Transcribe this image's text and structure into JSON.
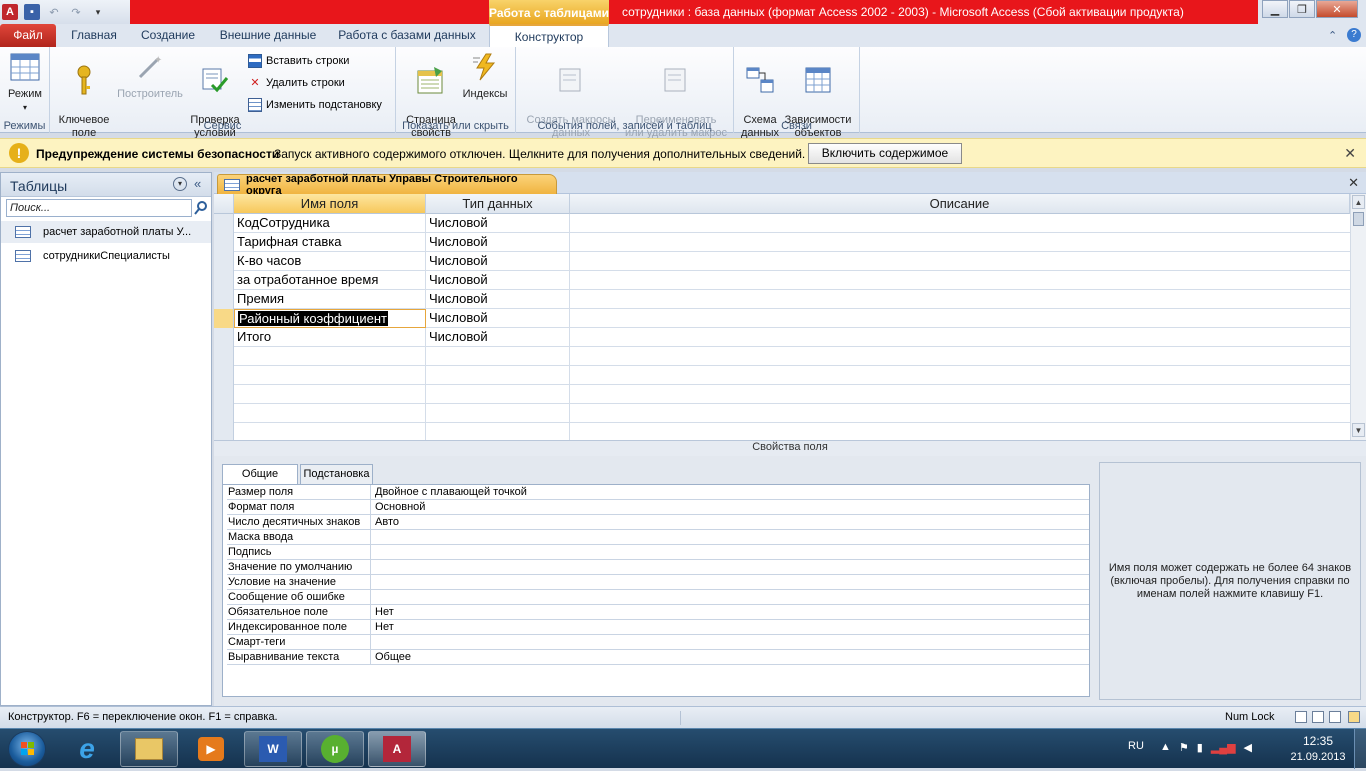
{
  "titlebar": {
    "context_tab": "Работа с таблицами",
    "window_title": "сотрудники : база данных (формат Access 2002 - 2003)  -  Microsoft Access (Сбой активации продукта)"
  },
  "tabs": {
    "file": "Файл",
    "home": "Главная",
    "create": "Создание",
    "external": "Внешние данные",
    "dbtools": "Работа с базами данных",
    "constructor": "Конструктор"
  },
  "ribbon": {
    "mode_label": "Режим",
    "group_modes": "Режимы",
    "key_field": "Ключевое\nполе",
    "builder": "Построитель",
    "check_conditions": "Проверка\nусловий",
    "insert_rows": "Вставить строки",
    "delete_rows": "Удалить строки",
    "change_lookup": "Изменить подстановку",
    "group_service": "Сервис",
    "property_sheet": "Страница\nсвойств",
    "indexes": "Индексы",
    "group_showhide": "Показать или скрыть",
    "create_macros": "Создать макросы\nданных",
    "rename_macro": "Переименовать\nили удалить макрос",
    "group_events": "События полей, записей и таблиц",
    "data_schema": "Схема\nданных",
    "dependencies": "Зависимости\nобъектов",
    "group_relations": "Связи"
  },
  "security": {
    "title": "Предупреждение системы безопасности",
    "message": "Запуск активного содержимого отключен. Щелкните для получения дополнительных сведений.",
    "button": "Включить содержимое"
  },
  "nav": {
    "title": "Таблицы",
    "search_placeholder": "Поиск...",
    "items": [
      {
        "label": "расчет заработной платы У..."
      },
      {
        "label": "сотрудникиСпециалисты"
      }
    ]
  },
  "document": {
    "tab_title": "расчет заработной платы Управы Строительного округа",
    "columns": [
      "Имя поля",
      "Тип данных",
      "Описание"
    ],
    "rows": [
      {
        "name": "КодСотрудника",
        "type": "Числовой"
      },
      {
        "name": "Тарифная ставка",
        "type": "Числовой"
      },
      {
        "name": "К-во часов",
        "type": "Числовой"
      },
      {
        "name": "за отработанное время",
        "type": "Числовой"
      },
      {
        "name": "Премия",
        "type": "Числовой"
      },
      {
        "name": "Районный коэффициент",
        "type": "Числовой"
      },
      {
        "name": "Итого",
        "type": "Числовой"
      }
    ]
  },
  "properties": {
    "section_label": "Свойства поля",
    "tab_general": "Общие",
    "tab_lookup": "Подстановка",
    "rows": [
      {
        "label": "Размер поля",
        "value": "Двойное с плавающей точкой"
      },
      {
        "label": "Формат поля",
        "value": "Основной"
      },
      {
        "label": "Число десятичных знаков",
        "value": "Авто"
      },
      {
        "label": "Маска ввода",
        "value": ""
      },
      {
        "label": "Подпись",
        "value": ""
      },
      {
        "label": "Значение по умолчанию",
        "value": ""
      },
      {
        "label": "Условие на значение",
        "value": ""
      },
      {
        "label": "Сообщение об ошибке",
        "value": ""
      },
      {
        "label": "Обязательное поле",
        "value": "Нет"
      },
      {
        "label": "Индексированное поле",
        "value": "Нет"
      },
      {
        "label": "Смарт-теги",
        "value": ""
      },
      {
        "label": "Выравнивание текста",
        "value": "Общее"
      }
    ],
    "help": "Имя поля может содержать не более 64 знаков (включая пробелы). Для получения справки по именам полей нажмите клавишу F1."
  },
  "status": {
    "text": "Конструктор.  F6 = переключение окон.  F1 = справка.",
    "numlock": "Num Lock"
  },
  "taskbar": {
    "lang": "RU",
    "time": "12:35",
    "date": "21.09.2013"
  },
  "colors": {
    "title_red": "#e8161b",
    "context_orange": "#e9a620",
    "file_tab": "#b1251c",
    "warning_bg": "#fdf3c1"
  }
}
